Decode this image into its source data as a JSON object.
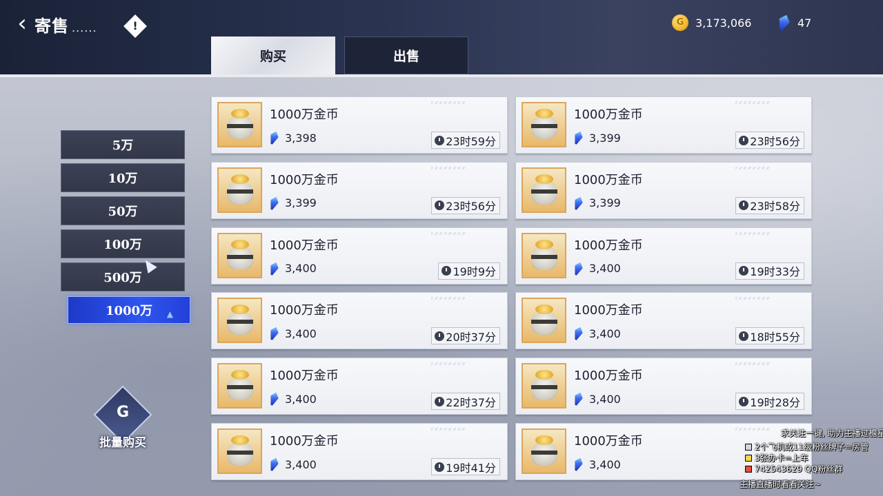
{
  "header": {
    "title": "寄售",
    "title_suffix": "......",
    "info_icon_glyph": "!",
    "gold_amount": "3,173,066",
    "gem_amount": "47",
    "coin_symbol": "G"
  },
  "tabs": {
    "buy": "购买",
    "sell": "出售"
  },
  "categories": [
    {
      "label": "5万",
      "active": false
    },
    {
      "label": "10万",
      "active": false
    },
    {
      "label": "50万",
      "active": false
    },
    {
      "label": "100万",
      "active": false
    },
    {
      "label": "500万",
      "active": false
    },
    {
      "label": "1000万",
      "active": true
    }
  ],
  "bulk_buy": {
    "label": "批量购买",
    "symbol": "G"
  },
  "listings": [
    {
      "name": "1000万金币",
      "price": "3,398",
      "time": "23时59分"
    },
    {
      "name": "1000万金币",
      "price": "3,399",
      "time": "23时56分"
    },
    {
      "name": "1000万金币",
      "price": "3,399",
      "time": "23时56分"
    },
    {
      "name": "1000万金币",
      "price": "3,399",
      "time": "23时58分"
    },
    {
      "name": "1000万金币",
      "price": "3,400",
      "time": "19时9分"
    },
    {
      "name": "1000万金币",
      "price": "3,400",
      "time": "19时33分"
    },
    {
      "name": "1000万金币",
      "price": "3,400",
      "time": "20时37分"
    },
    {
      "name": "1000万金币",
      "price": "3,400",
      "time": "18时55分"
    },
    {
      "name": "1000万金币",
      "price": "3,400",
      "time": "22时37分"
    },
    {
      "name": "1000万金币",
      "price": "3,400",
      "time": "19时28分"
    },
    {
      "name": "1000万金币",
      "price": "3,400",
      "time": "19时41分"
    },
    {
      "name": "1000万金币",
      "price": "3,400",
      "time": ""
    }
  ],
  "overlay": {
    "line1": "求关注一键, 助力主播过檐星!",
    "line2": "2个飞机或11级粉丝牌子=房管",
    "line3": "3张办卡=上车",
    "line4": "742543629 QQ粉丝群",
    "line5": "主播直播时看看关注~"
  },
  "colors": {
    "topbar": "#1a2238",
    "active_category": "#2f55ee",
    "card_bg": "#f7f8fb",
    "coin_gold": "#f1b82a",
    "gem_blue": "#3d6df0"
  }
}
